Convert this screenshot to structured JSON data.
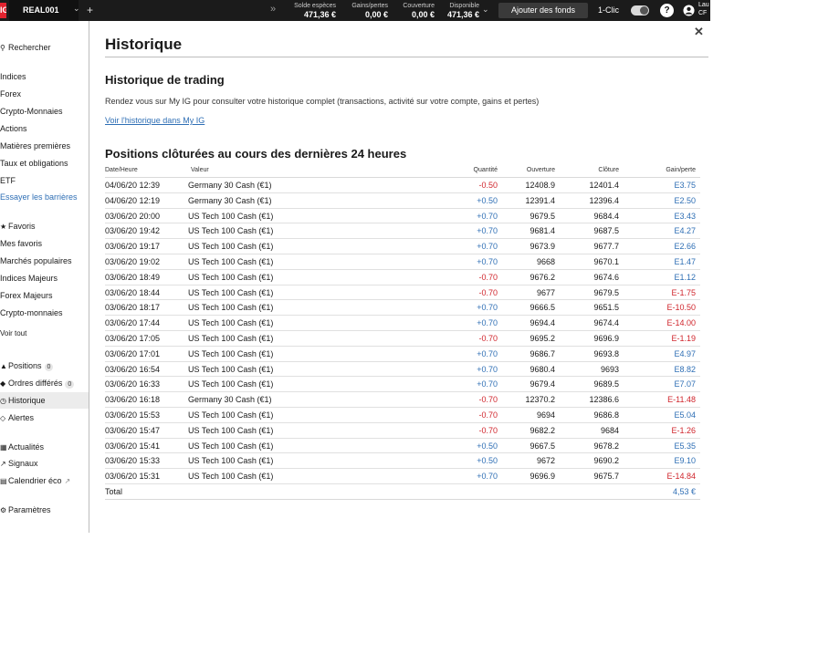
{
  "topbar": {
    "logo": "IG",
    "account": "REAL001",
    "stats": [
      {
        "label": "Solde espèces",
        "value": "471,36 €"
      },
      {
        "label": "Gains/pertes",
        "value": "0,00 €"
      },
      {
        "label": "Couverture",
        "value": "0,00 €"
      },
      {
        "label": "Disponible",
        "value": "471,36 €"
      }
    ],
    "fund_button": "Ajouter des fonds",
    "oneclick_label": "1-Clic",
    "help": "?",
    "user_line1": "Lau",
    "user_line2": "CF"
  },
  "sidebar": {
    "search": "Rechercher",
    "markets": [
      "Indices",
      "Forex",
      "Crypto-Monnaies",
      "Actions",
      "Matières premières",
      "Taux et obligations",
      "ETF"
    ],
    "barrier_link": "Essayer les barrières",
    "favorites": "Favoris",
    "watchlists": [
      "Mes favoris",
      "Marchés populaires",
      "Indices Majeurs",
      "Forex Majeurs",
      "Crypto-monnaies"
    ],
    "see_all": "Voir tout",
    "positions": "Positions",
    "positions_count": "0",
    "orders": "Ordres différés",
    "orders_count": "0",
    "history": "Historique",
    "alerts": "Alertes",
    "news": "Actualités",
    "signals": "Signaux",
    "calendar": "Calendrier éco",
    "settings": "Paramètres"
  },
  "main": {
    "title": "Historique",
    "trading_title": "Historique de trading",
    "trading_desc": "Rendez vous sur My IG pour consulter votre historique complet (transactions, activité sur votre compte, gains et pertes)",
    "myig_link": "Voir l'historique dans My IG",
    "closed_title": "Positions clôturées au cours des dernières 24 heures",
    "columns": {
      "date": "Date/Heure",
      "value": "Valeur",
      "qty": "Quantité",
      "open": "Ouverture",
      "close": "Clôture",
      "pnl": "Gain/perte"
    },
    "rows": [
      {
        "date": "04/06/20 12:39",
        "value": "Germany 30 Cash (€1)",
        "qty": "-0.50",
        "open": "12408.9",
        "close": "12401.4",
        "pnl": "E3.75"
      },
      {
        "date": "04/06/20 12:19",
        "value": "Germany 30 Cash (€1)",
        "qty": "+0.50",
        "open": "12391.4",
        "close": "12396.4",
        "pnl": "E2.50"
      },
      {
        "date": "03/06/20 20:00",
        "value": "US Tech 100 Cash (€1)",
        "qty": "+0.70",
        "open": "9679.5",
        "close": "9684.4",
        "pnl": "E3.43"
      },
      {
        "date": "03/06/20 19:42",
        "value": "US Tech 100 Cash (€1)",
        "qty": "+0.70",
        "open": "9681.4",
        "close": "9687.5",
        "pnl": "E4.27"
      },
      {
        "date": "03/06/20 19:17",
        "value": "US Tech 100 Cash (€1)",
        "qty": "+0.70",
        "open": "9673.9",
        "close": "9677.7",
        "pnl": "E2.66"
      },
      {
        "date": "03/06/20 19:02",
        "value": "US Tech 100 Cash (€1)",
        "qty": "+0.70",
        "open": "9668",
        "close": "9670.1",
        "pnl": "E1.47"
      },
      {
        "date": "03/06/20 18:49",
        "value": "US Tech 100 Cash (€1)",
        "qty": "-0.70",
        "open": "9676.2",
        "close": "9674.6",
        "pnl": "E1.12"
      },
      {
        "date": "03/06/20 18:44",
        "value": "US Tech 100 Cash (€1)",
        "qty": "-0.70",
        "open": "9677",
        "close": "9679.5",
        "pnl": "E-1.75"
      },
      {
        "date": "03/06/20 18:17",
        "value": "US Tech 100 Cash (€1)",
        "qty": "+0.70",
        "open": "9666.5",
        "close": "9651.5",
        "pnl": "E-10.50"
      },
      {
        "date": "03/06/20 17:44",
        "value": "US Tech 100 Cash (€1)",
        "qty": "+0.70",
        "open": "9694.4",
        "close": "9674.4",
        "pnl": "E-14.00"
      },
      {
        "date": "03/06/20 17:05",
        "value": "US Tech 100 Cash (€1)",
        "qty": "-0.70",
        "open": "9695.2",
        "close": "9696.9",
        "pnl": "E-1.19"
      },
      {
        "date": "03/06/20 17:01",
        "value": "US Tech 100 Cash (€1)",
        "qty": "+0.70",
        "open": "9686.7",
        "close": "9693.8",
        "pnl": "E4.97"
      },
      {
        "date": "03/06/20 16:54",
        "value": "US Tech 100 Cash (€1)",
        "qty": "+0.70",
        "open": "9680.4",
        "close": "9693",
        "pnl": "E8.82"
      },
      {
        "date": "03/06/20 16:33",
        "value": "US Tech 100 Cash (€1)",
        "qty": "+0.70",
        "open": "9679.4",
        "close": "9689.5",
        "pnl": "E7.07"
      },
      {
        "date": "03/06/20 16:18",
        "value": "Germany 30 Cash (€1)",
        "qty": "-0.70",
        "open": "12370.2",
        "close": "12386.6",
        "pnl": "E-11.48"
      },
      {
        "date": "03/06/20 15:53",
        "value": "US Tech 100 Cash (€1)",
        "qty": "-0.70",
        "open": "9694",
        "close": "9686.8",
        "pnl": "E5.04"
      },
      {
        "date": "03/06/20 15:47",
        "value": "US Tech 100 Cash (€1)",
        "qty": "-0.70",
        "open": "9682.2",
        "close": "9684",
        "pnl": "E-1.26"
      },
      {
        "date": "03/06/20 15:41",
        "value": "US Tech 100 Cash (€1)",
        "qty": "+0.50",
        "open": "9667.5",
        "close": "9678.2",
        "pnl": "E5.35"
      },
      {
        "date": "03/06/20 15:33",
        "value": "US Tech 100 Cash (€1)",
        "qty": "+0.50",
        "open": "9672",
        "close": "9690.2",
        "pnl": "E9.10"
      },
      {
        "date": "03/06/20 15:31",
        "value": "US Tech 100 Cash (€1)",
        "qty": "+0.70",
        "open": "9696.9",
        "close": "9675.7",
        "pnl": "E-14.84"
      }
    ],
    "total_label": "Total",
    "total_value": "4,53 €"
  },
  "colors": {
    "positive": "#2f6fb5",
    "negative": "#d0262d",
    "brand": "#e3232f"
  }
}
